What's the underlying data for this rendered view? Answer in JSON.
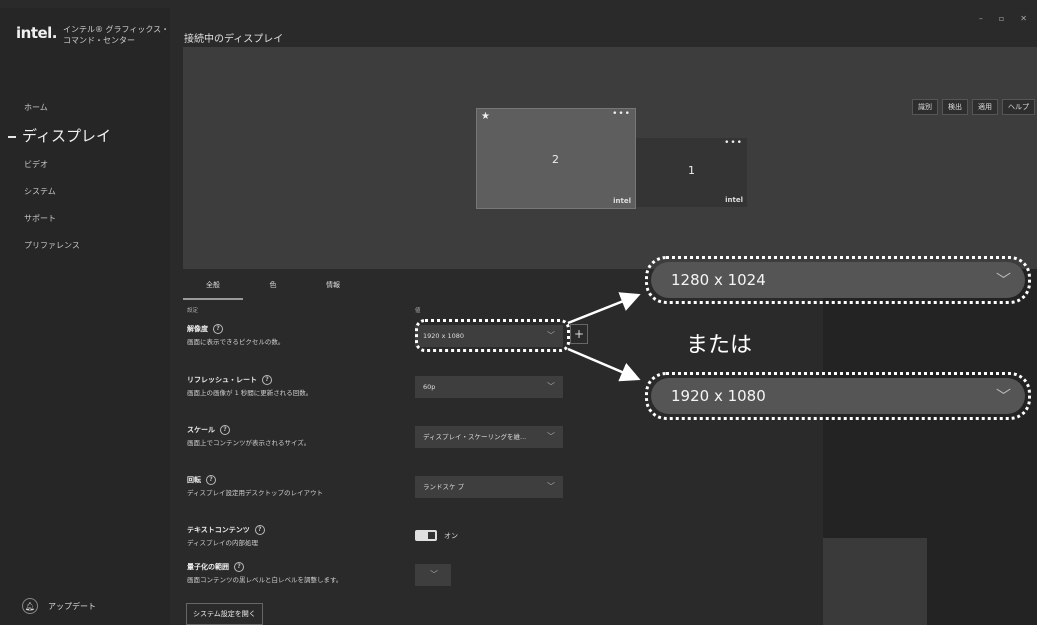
{
  "app": {
    "logo": "intel.",
    "name": "インテル® グラフィックス・コマンド・センター"
  },
  "window": {
    "minimize": "–",
    "maximize": "▫",
    "close": "✕"
  },
  "sidebar": {
    "items": [
      {
        "label": "ホーム"
      },
      {
        "label": "ディスプレイ"
      },
      {
        "label": "ビデオ"
      },
      {
        "label": "システム"
      },
      {
        "label": "サポート"
      },
      {
        "label": "プリファレンス"
      }
    ],
    "update_label": "アップデート"
  },
  "header": {
    "title": "接続中のディスプレイ"
  },
  "toolbar": {
    "identify": "識別",
    "detect": "検出",
    "apply": "適用",
    "help": "ヘルプ"
  },
  "monitors": {
    "m2": {
      "num": "2",
      "dots": "•••",
      "star": "★",
      "logo": "intel"
    },
    "m1": {
      "num": "1",
      "dots": "•••",
      "logo": "intel"
    }
  },
  "tabs": [
    {
      "label": "全般"
    },
    {
      "label": "色"
    },
    {
      "label": "情報"
    }
  ],
  "columns": {
    "settings": "設定",
    "value": "値"
  },
  "settings": {
    "resolution": {
      "title": "解像度",
      "desc": "画面に表示できるピクセルの数。",
      "value": "1920 x 1080"
    },
    "refresh": {
      "title": "リフレッシュ・レート",
      "desc": "画面上の画像が 1 秒間に更新される回数。",
      "value": "60p"
    },
    "scale": {
      "title": "スケール",
      "desc": "画面上でコンテンツが表示されるサイズ。",
      "value": "ディスプレイ・スケーリングを維..."
    },
    "rotation": {
      "title": "回転",
      "desc": "ディスプレイ設定用デスクトップのレイアウト",
      "value": "ランドスケ プ"
    },
    "text": {
      "title": "テキストコンテンツ",
      "desc": "ディスプレイの内部処理",
      "toggle": "オン"
    },
    "quant": {
      "title": "量子化の範囲",
      "desc": "画面コンテンツの黒レベルと白レベルを調整します。"
    }
  },
  "open_system_settings": "システム設定を開く",
  "help_glyph": "?",
  "plus_glyph": "+",
  "chevron": "﹀",
  "callouts": {
    "top": "1280 x 1024",
    "bottom": "1920 x 1080",
    "or": "または"
  }
}
